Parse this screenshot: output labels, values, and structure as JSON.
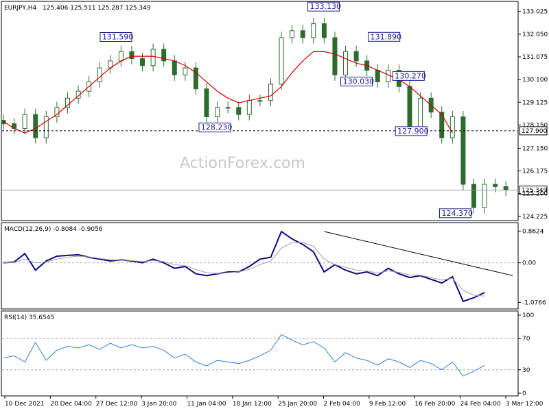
{
  "header": {
    "symbol": "EURJPY,H4",
    "ohlc": "125.406 125.511 125.287 125.349"
  },
  "watermark": "ActionForex.com",
  "colors": {
    "candle": "#2e6b2e",
    "ma": "#d00000",
    "macd_line": "#0a0a80",
    "signal": "#a0a0a0",
    "rsi": "#2f7fd0",
    "trend": "#000000",
    "frame": "#000000",
    "grid": "#999999"
  },
  "chart_data": [
    {
      "type": "candlestick",
      "title": "EURJPY,H4 125.406 125.511 125.287 125.349",
      "ylim": [
        124.1,
        133.4
      ],
      "y_ticks": [
        "133.025",
        "132.050",
        "131.075",
        "130.100",
        "129.125",
        "128.150",
        "127.150",
        "126.175",
        "125.200",
        "124.225"
      ],
      "x_ticks": [
        "10 Dec 2021",
        "20 Dec 04:00",
        "27 Dec 12:00",
        "3 Jan 20:00",
        "11 Jan 04:00",
        "18 Jan 12:00",
        "25 Jan 20:00",
        "2 Feb 04:00",
        "9 Feb 12:00",
        "16 Feb 20:00",
        "24 Feb 04:00",
        "3 Mar 12:00"
      ],
      "x": [
        0,
        4,
        8,
        12,
        16,
        20,
        24,
        28,
        32,
        36,
        40,
        44,
        48,
        52,
        56,
        60,
        64,
        68,
        72,
        76,
        80,
        84,
        88,
        92,
        96,
        100,
        104,
        108,
        112,
        116,
        120,
        124,
        128,
        132,
        136,
        140,
        144,
        148,
        152,
        156,
        160,
        164,
        168,
        172,
        176,
        180,
        184,
        188
      ],
      "close": [
        128.2,
        128.0,
        128.6,
        127.6,
        128.5,
        128.9,
        129.3,
        129.6,
        130.0,
        130.6,
        130.9,
        131.3,
        131.0,
        130.7,
        131.4,
        130.9,
        130.3,
        130.6,
        129.7,
        128.5,
        128.9,
        128.9,
        128.6,
        129.2,
        129.2,
        129.9,
        131.9,
        132.2,
        131.9,
        132.5,
        131.9,
        130.3,
        131.3,
        130.9,
        130.5,
        130.0,
        130.5,
        129.8,
        128.0,
        129.3,
        128.7,
        127.6,
        128.5,
        125.6,
        124.6,
        125.6,
        125.5,
        125.349
      ],
      "series": [
        {
          "name": "MA",
          "values": [
            128.3,
            128.0,
            127.8,
            128.0,
            128.3,
            128.6,
            129.0,
            129.4,
            129.8,
            130.2,
            130.6,
            130.9,
            131.1,
            131.1,
            131.1,
            131.0,
            130.9,
            130.7,
            130.4,
            130.0,
            129.6,
            129.3,
            129.1,
            129.2,
            129.3,
            129.4,
            129.8,
            130.4,
            130.9,
            131.3,
            131.3,
            131.2,
            131.0,
            130.8,
            130.7,
            130.5,
            130.3,
            130.1,
            129.8,
            129.4,
            129.0,
            128.6,
            127.8
          ]
        }
      ],
      "annotations": [
        {
          "label": "131.590",
          "x": 48,
          "y": 131.59
        },
        {
          "label": "128.230",
          "x": 86,
          "y": 128.23
        },
        {
          "label": "133.130",
          "x": 128,
          "y": 133.13
        },
        {
          "label": "131.890",
          "x": 136,
          "y": 131.89
        },
        {
          "label": "130.030",
          "x": 137,
          "y": 130.03
        },
        {
          "label": "130.270",
          "x": 158,
          "y": 130.27
        },
        {
          "label": "127.900",
          "x": 160,
          "y": 127.9
        },
        {
          "label": "124.370",
          "x": 176,
          "y": 124.37
        }
      ],
      "hlines": [
        {
          "value": 127.9,
          "label": "127.900",
          "style": "dashed"
        },
        {
          "value": 125.349,
          "label": "125.349",
          "style": "solid"
        }
      ],
      "grid": false
    },
    {
      "type": "line",
      "title": "MACD(12,26,9) -0.8084 -0.9056",
      "ylim": [
        -1.2,
        1.0
      ],
      "y_ticks": [
        "0.8624",
        "0.00",
        "-1.0766"
      ],
      "x": [
        0,
        4,
        8,
        12,
        16,
        20,
        24,
        28,
        32,
        36,
        40,
        44,
        48,
        52,
        56,
        60,
        64,
        68,
        72,
        76,
        80,
        84,
        88,
        92,
        96,
        100,
        104,
        108,
        112,
        116,
        120,
        124,
        128,
        132,
        136,
        140,
        144,
        148,
        152,
        156,
        160,
        164,
        168,
        172,
        176,
        180,
        184,
        188
      ],
      "series": [
        {
          "name": "MACD",
          "values": [
            0.0,
            0.02,
            0.25,
            -0.2,
            0.05,
            0.18,
            0.2,
            0.22,
            0.15,
            0.1,
            0.05,
            0.08,
            0.05,
            0.0,
            0.1,
            0.0,
            -0.15,
            -0.1,
            -0.3,
            -0.35,
            -0.3,
            -0.25,
            -0.25,
            -0.1,
            0.1,
            0.15,
            0.85,
            0.65,
            0.5,
            0.3,
            -0.25,
            -0.05,
            -0.2,
            -0.3,
            -0.25,
            -0.35,
            -0.15,
            -0.3,
            -0.4,
            -0.35,
            -0.45,
            -0.55,
            -0.38,
            -1.05,
            -0.95,
            -0.8084
          ]
        },
        {
          "name": "Signal",
          "values": [
            0.0,
            0.01,
            0.1,
            0.0,
            0.02,
            0.1,
            0.15,
            0.18,
            0.16,
            0.12,
            0.08,
            0.07,
            0.06,
            0.03,
            0.06,
            0.03,
            -0.05,
            -0.08,
            -0.18,
            -0.27,
            -0.29,
            -0.27,
            -0.25,
            -0.18,
            -0.05,
            0.05,
            0.4,
            0.55,
            0.55,
            0.45,
            0.1,
            -0.05,
            -0.12,
            -0.2,
            -0.22,
            -0.28,
            -0.22,
            -0.26,
            -0.33,
            -0.34,
            -0.4,
            -0.47,
            -0.42,
            -0.75,
            -0.88,
            -0.9056
          ]
        }
      ],
      "trendline": {
        "from": {
          "x": 120,
          "y": 0.85
        },
        "to": {
          "x": 188,
          "y": -0.35
        }
      },
      "zero_line": true
    },
    {
      "type": "line",
      "title": "RSI(14) 35.6545",
      "ylim": [
        0,
        100
      ],
      "y_ticks": [
        "100",
        "70",
        "30",
        "0"
      ],
      "x": [
        0,
        4,
        8,
        12,
        16,
        20,
        24,
        28,
        32,
        36,
        40,
        44,
        48,
        52,
        56,
        60,
        64,
        68,
        72,
        76,
        80,
        84,
        88,
        92,
        96,
        100,
        104,
        108,
        112,
        116,
        120,
        124,
        128,
        132,
        136,
        140,
        144,
        148,
        152,
        156,
        160,
        164,
        168,
        172,
        176,
        180,
        184,
        188
      ],
      "series": [
        {
          "name": "RSI",
          "values": [
            45,
            48,
            40,
            65,
            42,
            55,
            60,
            58,
            62,
            56,
            64,
            58,
            62,
            58,
            60,
            55,
            45,
            50,
            40,
            35,
            42,
            40,
            38,
            42,
            48,
            55,
            75,
            68,
            62,
            66,
            58,
            40,
            52,
            45,
            42,
            36,
            44,
            40,
            33,
            42,
            38,
            30,
            40,
            22,
            28,
            35.6545
          ]
        }
      ],
      "levels": [
        70,
        30
      ]
    }
  ]
}
